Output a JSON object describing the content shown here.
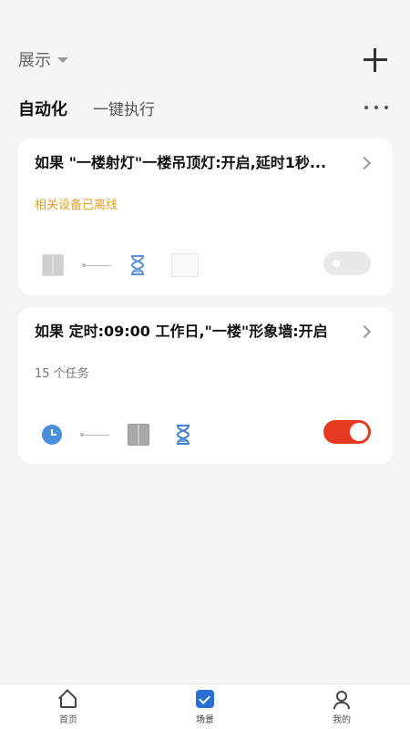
{
  "header": {
    "display_label": "展示",
    "add_icon": "plus-icon"
  },
  "tabs": [
    {
      "label": "自动化",
      "active": true
    },
    {
      "label": "一键执行",
      "active": false
    }
  ],
  "more_icon": "more-dots-icon",
  "automations": [
    {
      "title": "如果 \"一楼射灯\"一楼吊顶灯:开启,延时1秒...",
      "subtitle": "相关设备已离线",
      "subtitle_color": "#e0a020",
      "enabled": false,
      "flow_icons": [
        "switch-icon",
        "arrow-icon",
        "hourglass-icon",
        "light-switch-icon"
      ]
    },
    {
      "title": "如果 定时:09:00 工作日,\"一楼\"形象墙:开启",
      "subtitle": "15 个任务",
      "subtitle_color": "#777777",
      "enabled": true,
      "flow_icons": [
        "clock-icon",
        "arrow-icon",
        "switch-icon",
        "hourglass-icon"
      ]
    }
  ],
  "bottom_nav": [
    {
      "label": "首页",
      "icon": "home-icon",
      "active": false
    },
    {
      "label": "场景",
      "icon": "scene-check-icon",
      "active": true
    },
    {
      "label": "我的",
      "icon": "profile-icon",
      "active": false
    }
  ],
  "colors": {
    "accent_toggle_on": "#e53a1f",
    "scene_icon": "#2a6fd6",
    "background": "#f5f5f7",
    "warning": "#e0a020"
  }
}
